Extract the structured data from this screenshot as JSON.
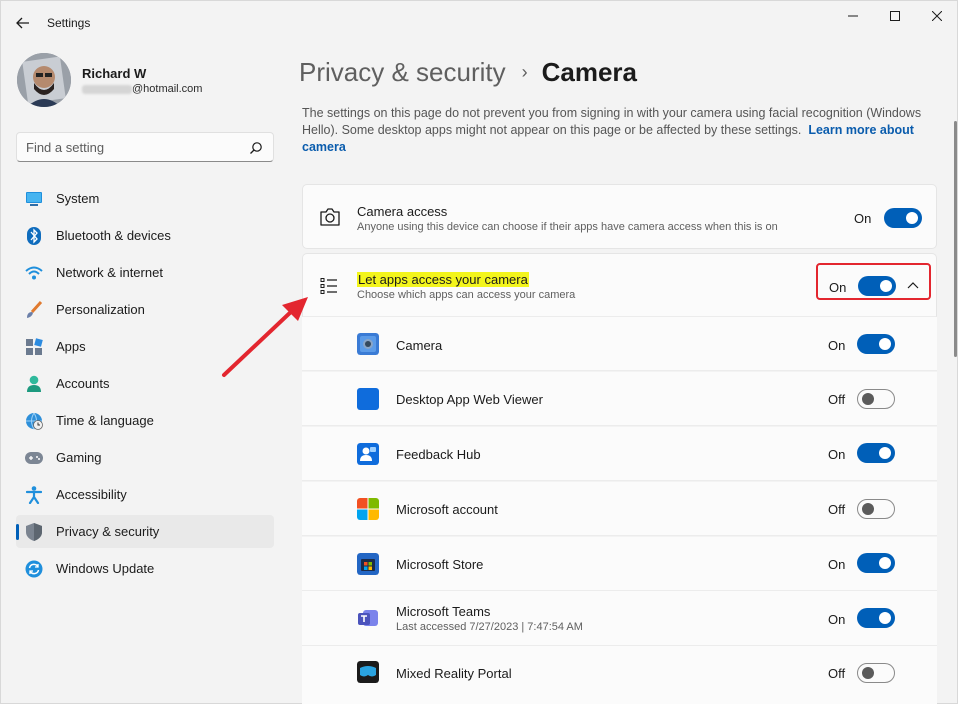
{
  "window": {
    "title": "Settings"
  },
  "user": {
    "name": "Richard W",
    "email_domain": "@hotmail.com"
  },
  "search": {
    "placeholder": "Find a setting"
  },
  "sidebar": {
    "items": [
      {
        "label": "System",
        "icon": "system-icon"
      },
      {
        "label": "Bluetooth & devices",
        "icon": "bluetooth-icon"
      },
      {
        "label": "Network & internet",
        "icon": "wifi-icon"
      },
      {
        "label": "Personalization",
        "icon": "brush-icon"
      },
      {
        "label": "Apps",
        "icon": "apps-icon"
      },
      {
        "label": "Accounts",
        "icon": "person-icon"
      },
      {
        "label": "Time & language",
        "icon": "globe-clock-icon"
      },
      {
        "label": "Gaming",
        "icon": "gamepad-icon"
      },
      {
        "label": "Accessibility",
        "icon": "accessibility-icon"
      },
      {
        "label": "Privacy & security",
        "icon": "shield-icon",
        "active": true
      },
      {
        "label": "Windows Update",
        "icon": "update-icon"
      }
    ]
  },
  "breadcrumb": {
    "parent": "Privacy & security",
    "separator": "›",
    "current": "Camera"
  },
  "info": {
    "text": "The settings on this page do not prevent you from signing in with your camera using facial recognition (Windows Hello). Some desktop apps might not appear on this page or be affected by these settings.",
    "link": "Learn more about camera"
  },
  "camera_access": {
    "title": "Camera access",
    "subtitle": "Anyone using this device can choose if their apps have camera access when this is on",
    "state": "On",
    "icon": "camera-icon"
  },
  "apps_access": {
    "title": "Let apps access your camera",
    "subtitle": "Choose which apps can access your camera",
    "state": "On",
    "icon": "list-icon"
  },
  "apps": [
    {
      "name": "Camera",
      "state": "On",
      "on": true,
      "subtitle": ""
    },
    {
      "name": "Desktop App Web Viewer",
      "state": "Off",
      "on": false,
      "subtitle": ""
    },
    {
      "name": "Feedback Hub",
      "state": "On",
      "on": true,
      "subtitle": ""
    },
    {
      "name": "Microsoft account",
      "state": "Off",
      "on": false,
      "subtitle": ""
    },
    {
      "name": "Microsoft Store",
      "state": "On",
      "on": true,
      "subtitle": ""
    },
    {
      "name": "Microsoft Teams",
      "state": "On",
      "on": true,
      "subtitle": "Last accessed 7/27/2023  |  7:47:54 AM"
    },
    {
      "name": "Mixed Reality Portal",
      "state": "Off",
      "on": false,
      "subtitle": ""
    }
  ],
  "colors": {
    "accent": "#005fb8",
    "highlight": "#f3f51c",
    "annotation_red": "#e3262f"
  }
}
